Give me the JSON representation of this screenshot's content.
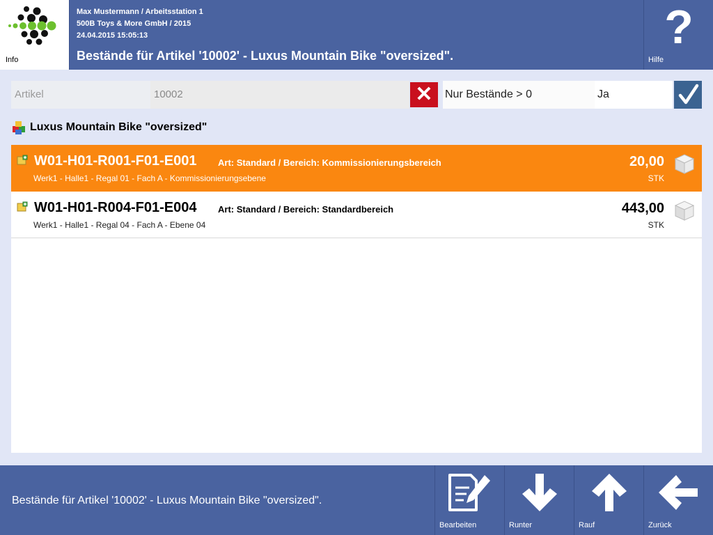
{
  "header": {
    "info_label": "Info",
    "user_line": "Max Mustermann / Arbeitsstation 1",
    "company_line": "500B Toys & More GmbH / 2015",
    "datetime": "24.04.2015 15:05:13",
    "title": "Bestände für Artikel '10002' - Luxus Mountain Bike \"oversized\".",
    "help_label": "Hilfe"
  },
  "filter": {
    "field_label": "Artikel",
    "field_value": "10002",
    "option_label": "Nur Bestände > 0",
    "option_value": "Ja"
  },
  "article": {
    "title": "Luxus Mountain Bike \"oversized\""
  },
  "stock_rows": [
    {
      "code": "W01-H01-R001-F01-E001",
      "meta": "Art: Standard / Bereich: Kommissionierungsbereich",
      "location": "Werk1 - Halle1 - Regal 01 - Fach A - Kommissionierungsebene",
      "quantity": "20,00",
      "unit": "STK",
      "selected": true
    },
    {
      "code": "W01-H01-R004-F01-E004",
      "meta": "Art: Standard / Bereich: Standardbereich",
      "location": "Werk1 - Halle1 - Regal 04 - Fach A - Ebene 04",
      "quantity": "443,00",
      "unit": "STK",
      "selected": false
    }
  ],
  "footer": {
    "status": "Bestände für Artikel '10002' - Luxus Mountain Bike \"oversized\".",
    "buttons": {
      "edit": "Bearbeiten",
      "down": "Runter",
      "up": "Rauf",
      "back": "Zurück"
    }
  },
  "colors": {
    "header_bg": "#4a63a0",
    "selected_row": "#fa8710",
    "clear_button": "#c9101e",
    "confirm_button": "#3b6391",
    "logo_green": "#6cc02e"
  }
}
